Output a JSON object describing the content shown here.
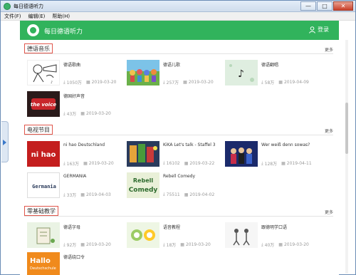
{
  "window": {
    "title": "每日德语听力",
    "minimize": "—",
    "maximize": "□",
    "close": "✕"
  },
  "menu": [
    "文件(F)",
    "编辑(E)",
    "帮助(H)"
  ],
  "header": {
    "title": "每日德语听力",
    "login": "登录"
  },
  "sections": [
    {
      "title": "德语音乐",
      "more": "更多",
      "items": [
        {
          "title": "德语歌曲",
          "count": "1050万",
          "date": "2019-03-20"
        },
        {
          "title": "德语儿歌",
          "count": "257万",
          "date": "2019-03-20"
        },
        {
          "title": "德语翻唱",
          "count": "58万",
          "date": "2019-04-09"
        },
        {
          "title": "德国好声音",
          "count": "43万",
          "date": "2019-03-20"
        }
      ]
    },
    {
      "title": "电视节目",
      "more": "更多",
      "items": [
        {
          "title": "ni hao Deutschland",
          "count": "163万",
          "date": "2019-03-20"
        },
        {
          "title": "KiKA Let's talk - Staffel 3",
          "count": "16102",
          "date": "2019-03-22"
        },
        {
          "title": "Wer weiß denn sowas?",
          "count": "128万",
          "date": "2019-04-11"
        },
        {
          "title": "GERMANIA",
          "count": "33万",
          "date": "2019-04-03"
        },
        {
          "title": "Rebell Comedy",
          "count": "75511",
          "date": "2019-04-02"
        }
      ]
    },
    {
      "title": "零基础教学",
      "more": "更多",
      "items": [
        {
          "title": "德语字母",
          "count": "92万",
          "date": "2019-03-20"
        },
        {
          "title": "语音教程",
          "count": "18万",
          "date": "2019-03-20"
        },
        {
          "title": "跟德明学口语",
          "count": "40万",
          "date": "2019-03-20"
        },
        {
          "title": "德语绕口令",
          "count": "",
          "date": ""
        }
      ]
    }
  ],
  "thumb_text": {
    "nihao": "ni hao",
    "germania": "Germania",
    "rebell1": "Rebell",
    "rebell2": "Comedy",
    "hallo1": "Hallo",
    "hallo2": "Deutschschule",
    "voice": "the voice"
  },
  "colors": {
    "brand": "#31b35c",
    "section_border": "#e0564b"
  }
}
